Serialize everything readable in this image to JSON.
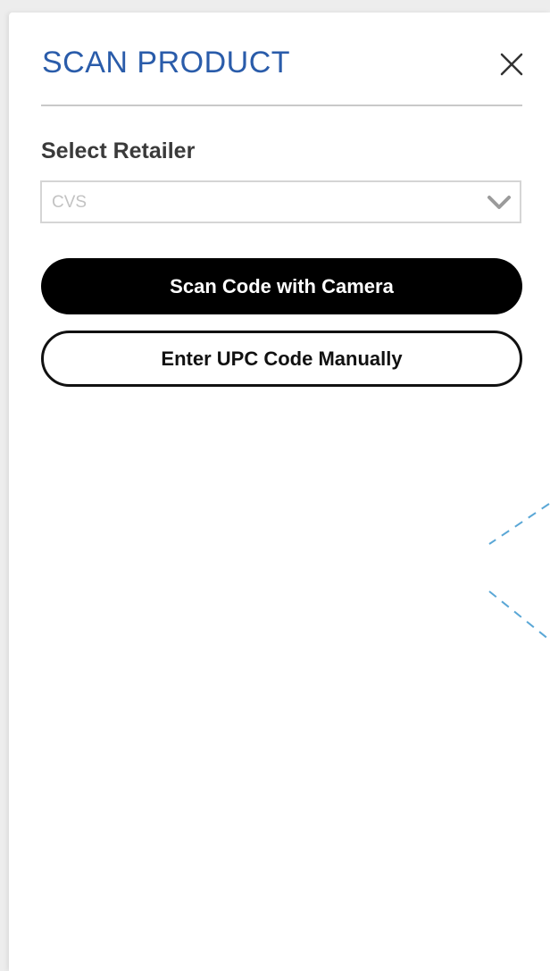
{
  "modal": {
    "title": "SCAN PRODUCT",
    "accent_color": "#2a5caa"
  },
  "retailer": {
    "label": "Select Retailer",
    "selected_value": "CVS"
  },
  "actions": {
    "scan_camera_label": "Scan Code with Camera",
    "manual_entry_label": "Enter UPC Code Manually"
  },
  "icons": {
    "close": "close-icon",
    "dropdown": "chevron-down-icon",
    "scan_guide": "scan-frame-outline"
  },
  "colors": {
    "scan_guide": "#5aa7d6"
  }
}
